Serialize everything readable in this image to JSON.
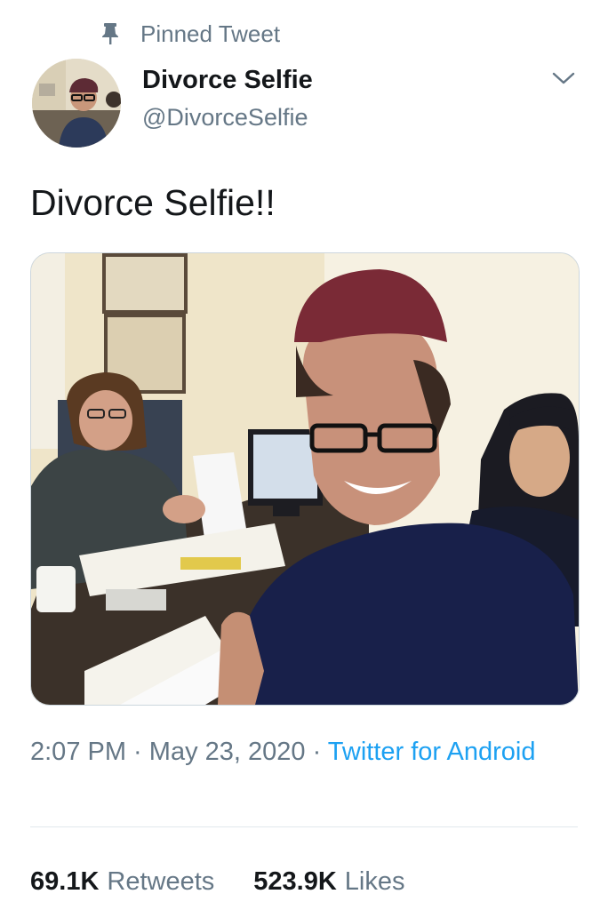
{
  "pinned": {
    "label": "Pinned Tweet",
    "icon": "pin-icon"
  },
  "author": {
    "display_name": "Divorce Selfie",
    "handle": "@DivorceSelfie"
  },
  "menu": {
    "icon": "chevron-down-icon"
  },
  "tweet": {
    "text": "Divorce Selfie!!"
  },
  "meta": {
    "time": "2:07 PM",
    "separator": " · ",
    "date": "May 23, 2020",
    "source": "Twitter for Android"
  },
  "stats": {
    "retweets": {
      "count": "69.1K",
      "label": "Retweets"
    },
    "likes": {
      "count": "523.9K",
      "label": "Likes"
    }
  },
  "colors": {
    "accent": "#1da1f2",
    "secondary_text": "#657786",
    "primary_text": "#14171a",
    "divider": "#e1e8ed"
  }
}
